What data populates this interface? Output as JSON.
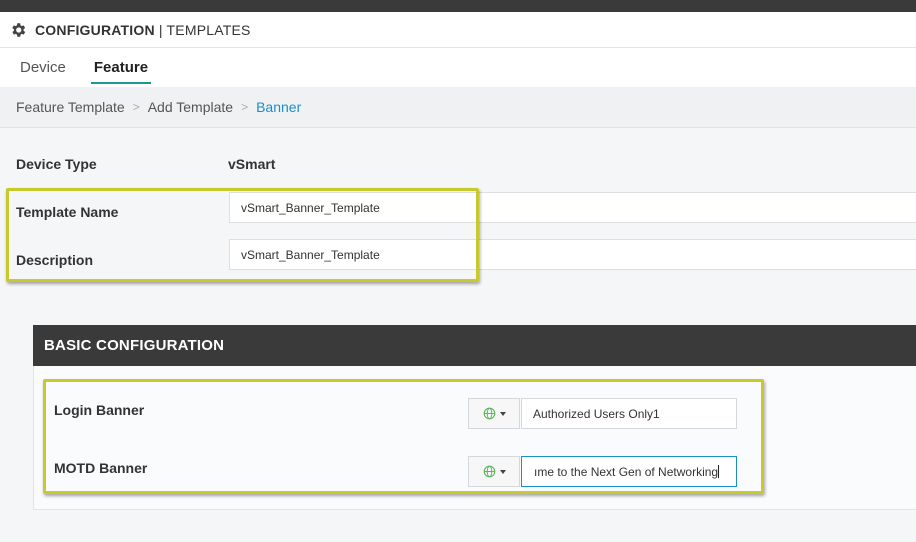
{
  "header": {
    "title_main": "CONFIGURATION",
    "title_sep": " | ",
    "title_sub": "TEMPLATES",
    "icon": "gear-icon"
  },
  "tabs": [
    {
      "label": "Device",
      "active": false
    },
    {
      "label": "Feature",
      "active": true
    }
  ],
  "breadcrumb": {
    "items": [
      "Feature Template",
      "Add Template"
    ],
    "current": "Banner",
    "separator": ">"
  },
  "form": {
    "device_type_label": "Device Type",
    "device_type_value": "vSmart",
    "template_name_label": "Template Name",
    "template_name_value": "vSmart_Banner_Template",
    "description_label": "Description",
    "description_value": "vSmart_Banner_Template"
  },
  "basic_config": {
    "header": "BASIC CONFIGURATION",
    "login_banner_label": "Login Banner",
    "login_banner_value": "Authorized Users Only1",
    "motd_banner_label": "MOTD Banner",
    "motd_banner_value": "ıme to the Next Gen of Networking",
    "scope_icon": "globe-icon"
  },
  "colors": {
    "accent": "#1b9a8f",
    "link": "#1a8fc9",
    "highlight": "#c8c92a",
    "dark": "#3a3a3a"
  }
}
